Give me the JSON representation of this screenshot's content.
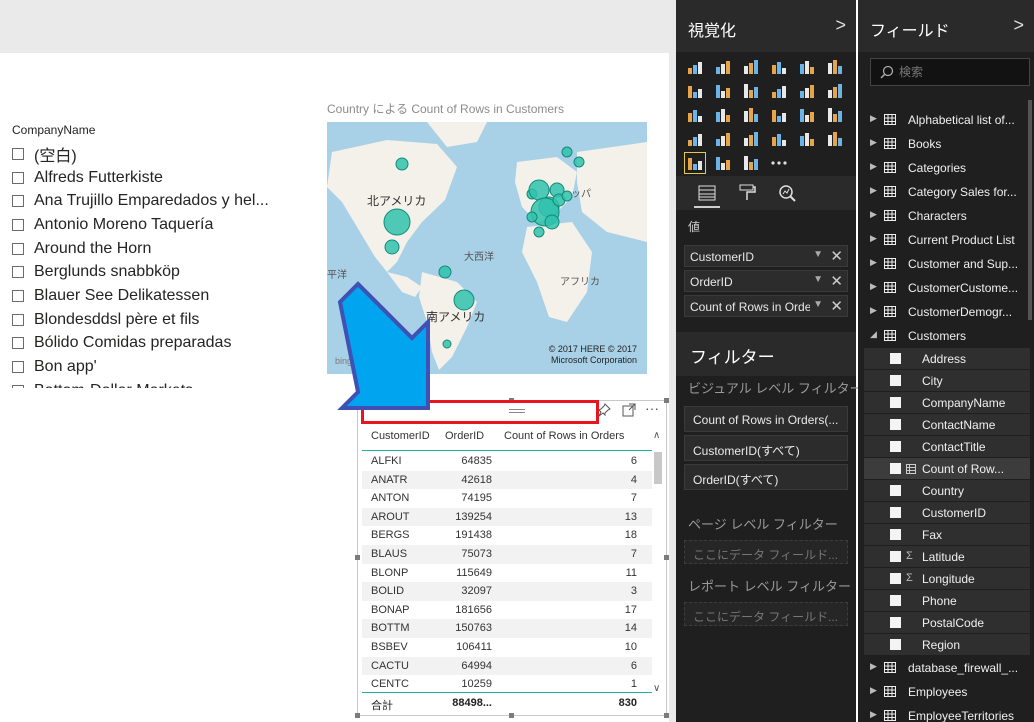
{
  "slicer": {
    "title": "CompanyName",
    "items": [
      "(空白)",
      "Alfreds Futterkiste",
      "Ana Trujillo Emparedados y hel...",
      "Antonio Moreno Taquería",
      "Around the Horn",
      "Berglunds snabbköp",
      "Blauer See Delikatessen",
      "Blondesddsl père et fils",
      "Bólido Comidas preparadas",
      "Bon app'",
      "Bottom-Dollar Markets"
    ]
  },
  "map": {
    "title": "Country による Count of Rows in Customers",
    "labels": {
      "north_america": "北アメリカ",
      "atlantic": "大西洋",
      "south_america": "南アメリカ",
      "africa": "アフリカ",
      "pacific": "平洋",
      "europe": "ッパ"
    },
    "copyright_line1": "© 2017 HERE   © 2017",
    "copyright_line2": "Microsoft Corporation",
    "bing": "bing"
  },
  "table": {
    "headers": [
      "CustomerID",
      "OrderID",
      "Count of Rows in Orders"
    ],
    "rows": [
      [
        "ALFKI",
        "64835",
        "6"
      ],
      [
        "ANATR",
        "42618",
        "4"
      ],
      [
        "ANTON",
        "74195",
        "7"
      ],
      [
        "AROUT",
        "139254",
        "13"
      ],
      [
        "BERGS",
        "191438",
        "18"
      ],
      [
        "BLAUS",
        "75073",
        "7"
      ],
      [
        "BLONP",
        "115649",
        "11"
      ],
      [
        "BOLID",
        "32097",
        "3"
      ],
      [
        "BONAP",
        "181656",
        "17"
      ],
      [
        "BOTTM",
        "150763",
        "14"
      ],
      [
        "BSBEV",
        "106411",
        "10"
      ],
      [
        "CACTU",
        "64994",
        "6"
      ],
      [
        "CENTC",
        "10259",
        "1"
      ]
    ],
    "total": [
      "合計",
      "88498...",
      "830"
    ]
  },
  "viz_pane": {
    "title": "視覚化",
    "chevron": ">",
    "values_label": "値",
    "wells": [
      "CustomerID",
      "OrderID",
      "Count of Rows in Orders"
    ],
    "more": "···"
  },
  "filters": {
    "title": "フィルター",
    "visual_level": "ビジュアル レベル フィルター",
    "visual_filters": [
      "Count of Rows in Orders(...",
      "CustomerID(すべて)",
      "OrderID(すべて)"
    ],
    "page_level": "ページ レベル フィルター",
    "page_drop": "ここにデータ フィールド...",
    "report_level": "レポート レベル フィルター",
    "report_drop": "ここにデータ フィールド..."
  },
  "fields_pane": {
    "title": "フィールド",
    "chevron": ">",
    "search_placeholder": "検索",
    "tables_before": [
      "Alphabetical list of...",
      "Books",
      "Categories",
      "Category Sales for...",
      "Characters",
      "Current Product List",
      "Customer and Sup...",
      "CustomerCustome...",
      "CustomerDemogr..."
    ],
    "expanded_table": "Customers",
    "fields": [
      {
        "name": "Address",
        "type": ""
      },
      {
        "name": "City",
        "type": ""
      },
      {
        "name": "CompanyName",
        "type": ""
      },
      {
        "name": "ContactName",
        "type": ""
      },
      {
        "name": "ContactTitle",
        "type": ""
      },
      {
        "name": "Count of Row...",
        "type": "table"
      },
      {
        "name": "Country",
        "type": ""
      },
      {
        "name": "CustomerID",
        "type": ""
      },
      {
        "name": "Fax",
        "type": ""
      },
      {
        "name": "Latitude",
        "type": "Σ"
      },
      {
        "name": "Longitude",
        "type": "Σ"
      },
      {
        "name": "Phone",
        "type": ""
      },
      {
        "name": "PostalCode",
        "type": ""
      },
      {
        "name": "Region",
        "type": ""
      }
    ],
    "tables_after": [
      "database_firewall_...",
      "Employees",
      "EmployeeTerritories"
    ]
  },
  "colors": {
    "accent": "#1fb0a0",
    "highlight_red": "#e8141e",
    "arrow_blue": "#00a4ef",
    "pane_bg": "#1f1f1f"
  }
}
